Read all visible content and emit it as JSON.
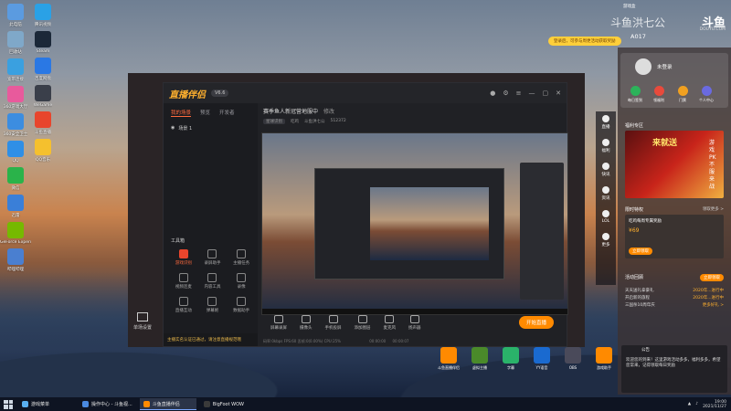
{
  "desktop": {
    "icons_left": [
      {
        "label": "此电脑",
        "color": "#5b9be0"
      },
      {
        "label": "回收站",
        "color": "#7fa8c9"
      },
      {
        "label": "宽带连接",
        "color": "#3aa0e0"
      },
      {
        "label": "360游戏大厅",
        "color": "#e85a9c"
      },
      {
        "label": "360安全卫士",
        "color": "#3c8de0"
      },
      {
        "label": "QQ",
        "color": "#2f8fe6"
      },
      {
        "label": "微信",
        "color": "#2ab34a"
      },
      {
        "label": "迅雷",
        "color": "#3a7fd8"
      },
      {
        "label": "GeForce Experience",
        "color": "#76b900"
      },
      {
        "label": "哔哩哔哩",
        "color": "#4a7fd0"
      }
    ],
    "icons_right": [
      {
        "label": "腾讯视频",
        "color": "#2aa1e6"
      },
      {
        "label": "Steam",
        "color": "#1b2838"
      },
      {
        "label": "百度网盘",
        "color": "#2a78e4"
      },
      {
        "label": "WeGame",
        "color": "#3a3f4a"
      },
      {
        "label": "斗鱼直播",
        "color": "#e8452c"
      },
      {
        "label": "QQ音乐",
        "color": "#f5c02e"
      }
    ]
  },
  "app": {
    "logo": "直播伴侣",
    "version_badge": "V6.6",
    "tabs": [
      "我的场景",
      "预览",
      "开发者"
    ],
    "scene_label": "场景 1",
    "room_title": "赛季鱼人新冠营地服中",
    "room_edit": "修改",
    "room_tags": [
      "星球识别",
      "吃鸡",
      "斗鱼洪七公",
      "512372"
    ],
    "toolbar_label": "工具箱",
    "tools": [
      "游戏识别",
      "录屏助手",
      "主播任务",
      "视频连麦",
      "内容工具",
      "录像",
      "直播互动",
      "弹幕姬",
      "数据助手"
    ],
    "scene_panel_label": "单场设置",
    "bottom_items": [
      "屏幕录屏",
      "摄像头",
      "手机投屏",
      "添加图层",
      "麦克风",
      "扬声器"
    ],
    "live_button": "开始直播",
    "timer_1": "00:00:00",
    "timer_2": "00:00:07",
    "status_line": "码率:0kbps  FPS:60  丢帧:0(0.00%)  CPU:25%",
    "notice": "主播实名认证已通过，请注意直播规范哦"
  },
  "right_panel": {
    "top_small": "游戏盒",
    "watermark": "斗鱼洪七公",
    "logo": "斗鱼",
    "site": "DOUYU.COM",
    "room_id": "A017",
    "promo": "登录后，可参与周更活动获取奖励",
    "login_text": "未登录",
    "login_buttons": [
      {
        "label": "每日签到",
        "color": "#2cb35a"
      },
      {
        "label": "领福利",
        "color": "#e84a3c"
      },
      {
        "label": "门票",
        "color": "#f0a020"
      },
      {
        "label": "个人中心",
        "color": "#6a6ae0"
      }
    ],
    "side_tabs": [
      "直播",
      "福利",
      "快讯",
      "资讯",
      "LOL",
      "更多"
    ],
    "welfare_title": "福利专区",
    "banner_text": "来就送",
    "banner_side": "游戏PK 不服来战",
    "limited_title": "限时特权",
    "limited_more": "领取更多 >",
    "game_card_title": "吃鸡每周专属奖励",
    "game_card_price": "¥69",
    "game_card_btn": "立即领取",
    "activity_title": "活动回顾",
    "activity_btn": "立即领取",
    "rows": [
      {
        "left": "天天送礼拿豪礼",
        "right": "2020年...进行中"
      },
      {
        "left": "开启新的旅程",
        "right": "2020年...进行中"
      },
      {
        "left": "三国杀10周年庆",
        "right": "更多好礼 >"
      }
    ],
    "msg_title": "公告",
    "msg_text": "欢迎您的到来！这里游戏活动多多，福利多多，希望您常来，记得领取每日奖励"
  },
  "shortcuts": [
    {
      "label": "斗鱼直播伴侣",
      "color": "#ff8a00"
    },
    {
      "label": "虚拟主播",
      "color": "#4a8a2a"
    },
    {
      "label": "字幕",
      "color": "#2ab36a"
    },
    {
      "label": "YY语音",
      "color": "#1a6ad0"
    },
    {
      "label": "OBS",
      "color": "#4a4a5a"
    },
    {
      "label": "游戏助手",
      "color": "#ff8a00"
    }
  ],
  "taskbar": {
    "apps": [
      {
        "label": "游戏菜单",
        "color": "#5ab0f0",
        "active": false
      },
      {
        "label": "操作中心 - 斗鱼视...",
        "color": "#4a8ae0",
        "active": false
      },
      {
        "label": "斗鱼直播伴侣",
        "color": "#ff8a00",
        "active": true
      },
      {
        "label": "BigFoot WOW",
        "color": "#3a3a3a",
        "active": false
      }
    ],
    "time": "19:00",
    "date": "2021/11/27"
  }
}
